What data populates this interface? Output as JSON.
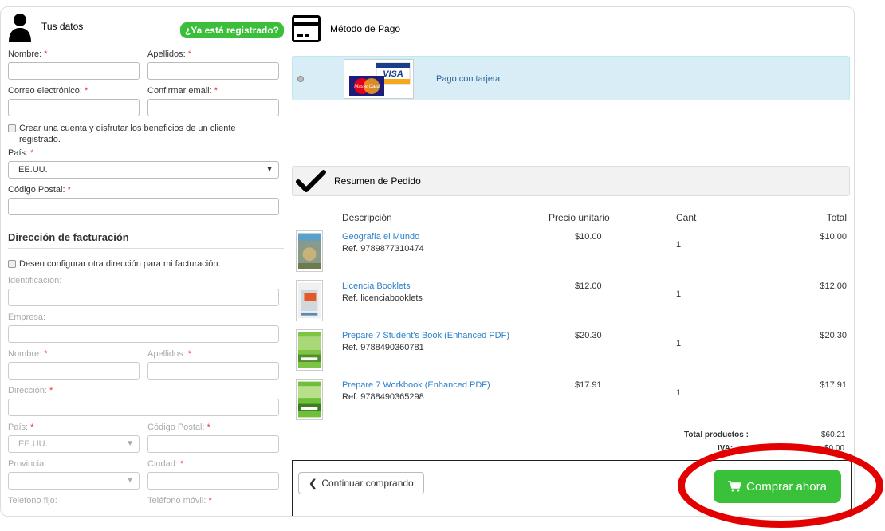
{
  "tus_datos": {
    "title": "Tus datos",
    "registered_badge": "¿Ya está registrado?",
    "nombre_label": "Nombre:",
    "apellidos_label": "Apellidos:",
    "correo_label": "Correo electrónico:",
    "confirmar_label": "Confirmar email:",
    "crear_cuenta_text": "Crear una cuenta y disfrutar los beneficios de un cliente registrado.",
    "pais_label": "País:",
    "pais_value": "EE.UU.",
    "cp_label": "Código Postal:",
    "required_mark": "*"
  },
  "facturacion": {
    "title": "Dirección de facturación",
    "checkbox_text": "Deseo configurar otra dirección para mi facturación.",
    "identificacion_label": "Identificación:",
    "empresa_label": "Empresa:",
    "nombre_label": "Nombre:",
    "apellidos_label": "Apellidos:",
    "direccion_label": "Dirección:",
    "pais_label": "País:",
    "pais_value": "EE.UU.",
    "cp_label": "Código Postal:",
    "provincia_label": "Provincia:",
    "ciudad_label": "Ciudad:",
    "telefono_fijo_label": "Teléfono fijo:",
    "telefono_movil_label": "Teléfono móvil:"
  },
  "metodo_pago": {
    "title": "Método de Pago",
    "option_label": "Pago con tarjeta",
    "visa_text": "VISA",
    "mastercard_text": "MasterCard"
  },
  "resumen": {
    "title": "Resumen de Pedido",
    "headers": {
      "descripcion": "Descripción",
      "precio": "Precio unitario",
      "cant": "Cant",
      "total": "Total"
    },
    "items": [
      {
        "name": "Geografía el Mundo",
        "ref": "Ref. 9789877310474",
        "price": "$10.00",
        "qty": "1",
        "total": "$10.00"
      },
      {
        "name": "Licencia Booklets",
        "ref": "Ref. licenciabooklets",
        "price": "$12.00",
        "qty": "1",
        "total": "$12.00"
      },
      {
        "name": "Prepare 7 Student's Book (Enhanced PDF)",
        "ref": "Ref. 9788490360781",
        "price": "$20.30",
        "qty": "1",
        "total": "$20.30"
      },
      {
        "name": "Prepare 7 Workbook (Enhanced PDF)",
        "ref": "Ref. 9788490365298",
        "price": "$17.91",
        "qty": "1",
        "total": "$17.91"
      }
    ],
    "total_productos_label": "Total productos :",
    "total_productos_value": "$60.21",
    "iva_label": "IVA:",
    "iva_value": "$0.00"
  },
  "actions": {
    "continuar": "Continuar comprando",
    "comprar": "Comprar ahora"
  },
  "colors": {
    "accent_green": "#39c239",
    "highlight_red": "#e30000",
    "link_blue": "#2a7fc9",
    "pay_box_bg": "#d9edf7"
  }
}
